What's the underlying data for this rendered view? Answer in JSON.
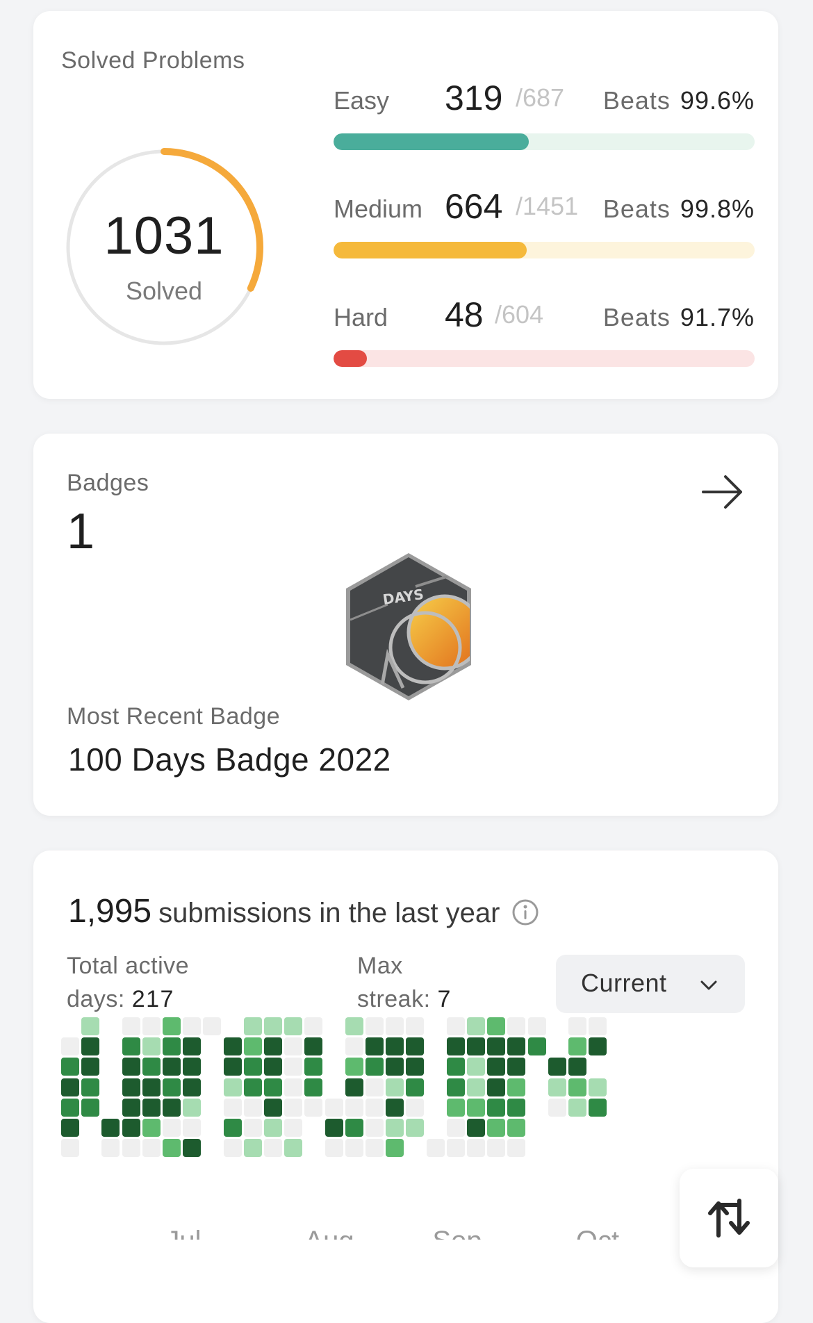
{
  "solved": {
    "title": "Solved Problems",
    "total": "1031",
    "label": "Solved",
    "ring_fraction": 0.32,
    "rows": [
      {
        "name": "Easy",
        "solved": "319",
        "total": "/687",
        "beats_label": "Beats",
        "beats": "99.6%",
        "fraction": 0.464,
        "color": "#4aad9b",
        "track": "#e8f5ee"
      },
      {
        "name": "Medium",
        "solved": "664",
        "total": "/1451",
        "beats_label": "Beats",
        "beats": "99.8%",
        "fraction": 0.458,
        "color": "#f5b93b",
        "track": "#fdf4dc"
      },
      {
        "name": "Hard",
        "solved": "48",
        "total": "/604",
        "beats_label": "Beats",
        "beats": "91.7%",
        "fraction": 0.079,
        "color": "#e34b43",
        "track": "#fbe4e4"
      }
    ]
  },
  "badges": {
    "title": "Badges",
    "count": "1",
    "recent_label": "Most Recent Badge",
    "recent_name": "100 Days Badge 2022",
    "badge_text": "DAYS"
  },
  "submissions": {
    "count": "1,995",
    "text": "submissions in the last year",
    "active_label_1": "Total active",
    "active_label_2": "days:",
    "active_value": "217",
    "streak_label_1": "Max",
    "streak_label_2": "streak:",
    "streak_value": "7",
    "select_value": "Current",
    "months": [
      "Jul",
      "Aug",
      "Sep",
      "Oct"
    ],
    "colors": [
      "#efefef",
      "#a6dcb1",
      "#5eba6e",
      "#2f8a45",
      "#1d5b2e"
    ],
    "heatmap": [
      [
        "-",
        "1",
        "-",
        "-",
        "-",
        "-",
        "-",
        "-",
        "-",
        "-",
        "-",
        "-",
        "-",
        "-",
        "-",
        "-",
        "-",
        "-",
        "-",
        "-",
        "-",
        "-",
        "-",
        "-",
        "-",
        "-",
        "-",
        "-",
        "-",
        "-",
        "-",
        "-",
        "-"
      ],
      [
        "0",
        "4",
        "-",
        "-",
        "-",
        "-",
        "-",
        "-",
        "-",
        "-",
        "-",
        "-",
        "-",
        "-",
        "-",
        "-",
        "-",
        "-",
        "-",
        "-",
        "-",
        "-",
        "-",
        "-",
        "-",
        "-",
        "-",
        "-",
        "-",
        "-",
        "-",
        "-",
        "-"
      ],
      [
        "3",
        "4",
        "-",
        "-",
        "-",
        "-",
        "-",
        "-",
        "-",
        "-",
        "-",
        "-",
        "-",
        "-",
        "-",
        "-",
        "-",
        "-",
        "-",
        "-",
        "-",
        "-",
        "-",
        "-",
        "-",
        "-",
        "-",
        "-",
        "-",
        "-",
        "-",
        "-",
        "-"
      ],
      [
        "4",
        "3",
        "-",
        "-",
        "-",
        "-",
        "-",
        "-",
        "-",
        "-",
        "-",
        "-",
        "-",
        "-",
        "-",
        "-",
        "-",
        "-",
        "-",
        "-",
        "-",
        "-",
        "-",
        "-",
        "-",
        "-",
        "-",
        "-",
        "-",
        "-",
        "-",
        "-",
        "-"
      ],
      [
        "3",
        "3",
        "-",
        "-",
        "-",
        "-",
        "-",
        "-",
        "-",
        "-",
        "-",
        "-",
        "-",
        "-",
        "-",
        "-",
        "-",
        "-",
        "-",
        "-",
        "-",
        "-",
        "-",
        "-",
        "-",
        "-",
        "-",
        "-",
        "-",
        "-",
        "-",
        "-",
        "-"
      ],
      [
        "4",
        "-",
        "-",
        "-",
        "-",
        "-",
        "-",
        "-",
        "-",
        "-",
        "-",
        "-",
        "-",
        "-",
        "-",
        "-",
        "-",
        "-",
        "-",
        "-",
        "-",
        "-",
        "-",
        "-",
        "-",
        "-",
        "-",
        "-",
        "-",
        "-",
        "-",
        "-",
        "-"
      ],
      [
        "0",
        "-",
        "-",
        "-",
        "-",
        "-",
        "-",
        "-",
        "-",
        "-",
        "-",
        "-",
        "-",
        "-",
        "-",
        "-",
        "-",
        "-",
        "-",
        "-",
        "-",
        "-",
        "-",
        "-",
        "-",
        "-",
        "-",
        "-",
        "-",
        "-",
        "-",
        "-",
        "-"
      ]
    ],
    "weeks": [
      [
        "-",
        "0",
        "3",
        "4",
        "3",
        "4",
        "0"
      ],
      [
        "1",
        "4",
        "4",
        "3",
        "3",
        "-",
        "-"
      ],
      [
        "-",
        "-",
        "-",
        "-",
        "-",
        "4",
        "0"
      ],
      [
        "0",
        "3",
        "4",
        "4",
        "4",
        "4",
        "0"
      ],
      [
        "0",
        "1",
        "3",
        "4",
        "4",
        "2",
        "0"
      ],
      [
        "2",
        "3",
        "4",
        "3",
        "4",
        "0",
        "2"
      ],
      [
        "0",
        "4",
        "4",
        "4",
        "1",
        "0",
        "4"
      ],
      [
        "0",
        "-",
        "-",
        "-",
        "-",
        "-",
        "-"
      ],
      [
        "-",
        "4",
        "4",
        "1",
        "0",
        "3",
        "0"
      ],
      [
        "1",
        "2",
        "3",
        "3",
        "0",
        "0",
        "1"
      ],
      [
        "1",
        "4",
        "4",
        "3",
        "4",
        "1",
        "0"
      ],
      [
        "1",
        "0",
        "0",
        "0",
        "0",
        "0",
        "1"
      ],
      [
        "0",
        "4",
        "3",
        "3",
        "0",
        "-",
        "-"
      ],
      [
        "-",
        "-",
        "-",
        "-",
        "0",
        "4",
        "0"
      ],
      [
        "1",
        "0",
        "2",
        "4",
        "0",
        "3",
        "0"
      ],
      [
        "0",
        "4",
        "3",
        "0",
        "0",
        "0",
        "0"
      ],
      [
        "0",
        "4",
        "4",
        "1",
        "4",
        "1",
        "2"
      ],
      [
        "0",
        "4",
        "4",
        "3",
        "0",
        "1",
        "-"
      ],
      [
        "-",
        "-",
        "-",
        "-",
        "-",
        "-",
        "0"
      ],
      [
        "0",
        "4",
        "3",
        "3",
        "2",
        "0",
        "0"
      ],
      [
        "1",
        "4",
        "1",
        "1",
        "2",
        "4",
        "0"
      ],
      [
        "2",
        "4",
        "4",
        "4",
        "3",
        "2",
        "0"
      ],
      [
        "0",
        "4",
        "4",
        "2",
        "3",
        "2",
        "0"
      ],
      [
        "0",
        "3",
        "-",
        "-",
        "-",
        "-",
        "-"
      ],
      [
        "-",
        "-",
        "4",
        "1",
        "0",
        "-",
        "-"
      ],
      [
        "0",
        "2",
        "4",
        "2",
        "1",
        "-",
        "-"
      ],
      [
        "0",
        "4",
        "-",
        "1",
        "3",
        "-",
        "-"
      ]
    ]
  }
}
